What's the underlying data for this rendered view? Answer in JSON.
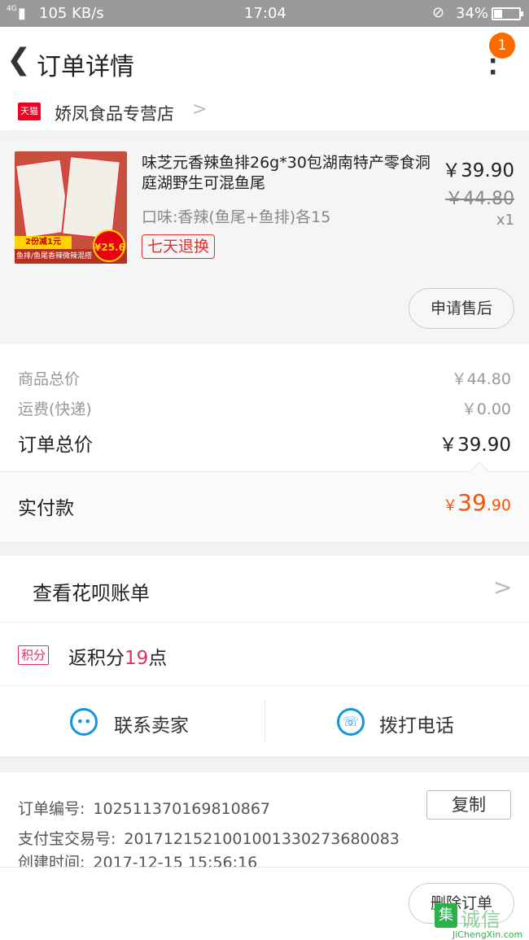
{
  "status_bar": {
    "network": "4G",
    "speed": "105 KB/s",
    "time": "17:04",
    "battery": "34%",
    "battery_level": 0.34
  },
  "nav": {
    "title": "订单详情",
    "badge_count": "1"
  },
  "shop": {
    "tmall_label": "天猫",
    "name": "娇凤食品专营店"
  },
  "item": {
    "thumb_promo": "2份减1元",
    "thumb_stripe": "鱼排/鱼尾香辣微辣混搭",
    "thumb_price": "¥25.6",
    "title": "味芝元香辣鱼排26g*30包湖南特产零食洞庭湖野生可混鱼尾",
    "sku": "口味:香辣(鱼尾+鱼排)各15",
    "return_tag": "七天退换",
    "price": "￥39.90",
    "original_price": "￥44.80",
    "quantity": "x1",
    "after_sale_button": "申请售后"
  },
  "summary": {
    "goods_total_label": "商品总价",
    "goods_total_value": "￥44.80",
    "shipping_label": "运费(快递)",
    "shipping_value": "￥0.00",
    "order_total_label": "订单总价",
    "order_total_value": "￥39.90"
  },
  "paid": {
    "label": "实付款",
    "currency": "￥",
    "integer": "39",
    "decimal": ".90"
  },
  "huabei": {
    "label": "查看花呗账单"
  },
  "points": {
    "tag": "积分",
    "prefix": "返积分",
    "amount": "19",
    "suffix": "点"
  },
  "contact": {
    "seller_label": "联系卖家",
    "phone_label": "拨打电话"
  },
  "order_info": {
    "order_no_label": "订单编号:",
    "order_no": "102511370169810867",
    "copy_button": "复制",
    "alipay_label": "支付宝交易号:",
    "alipay_no": "2017121521001001330273680083",
    "created_label": "创建时间:",
    "created_time": "2017-12-15 15:56:16"
  },
  "footer": {
    "delete_button": "删除订单"
  },
  "watermark": {
    "mark": "集",
    "cn": "诚信",
    "en": "JiChengXin.com"
  }
}
